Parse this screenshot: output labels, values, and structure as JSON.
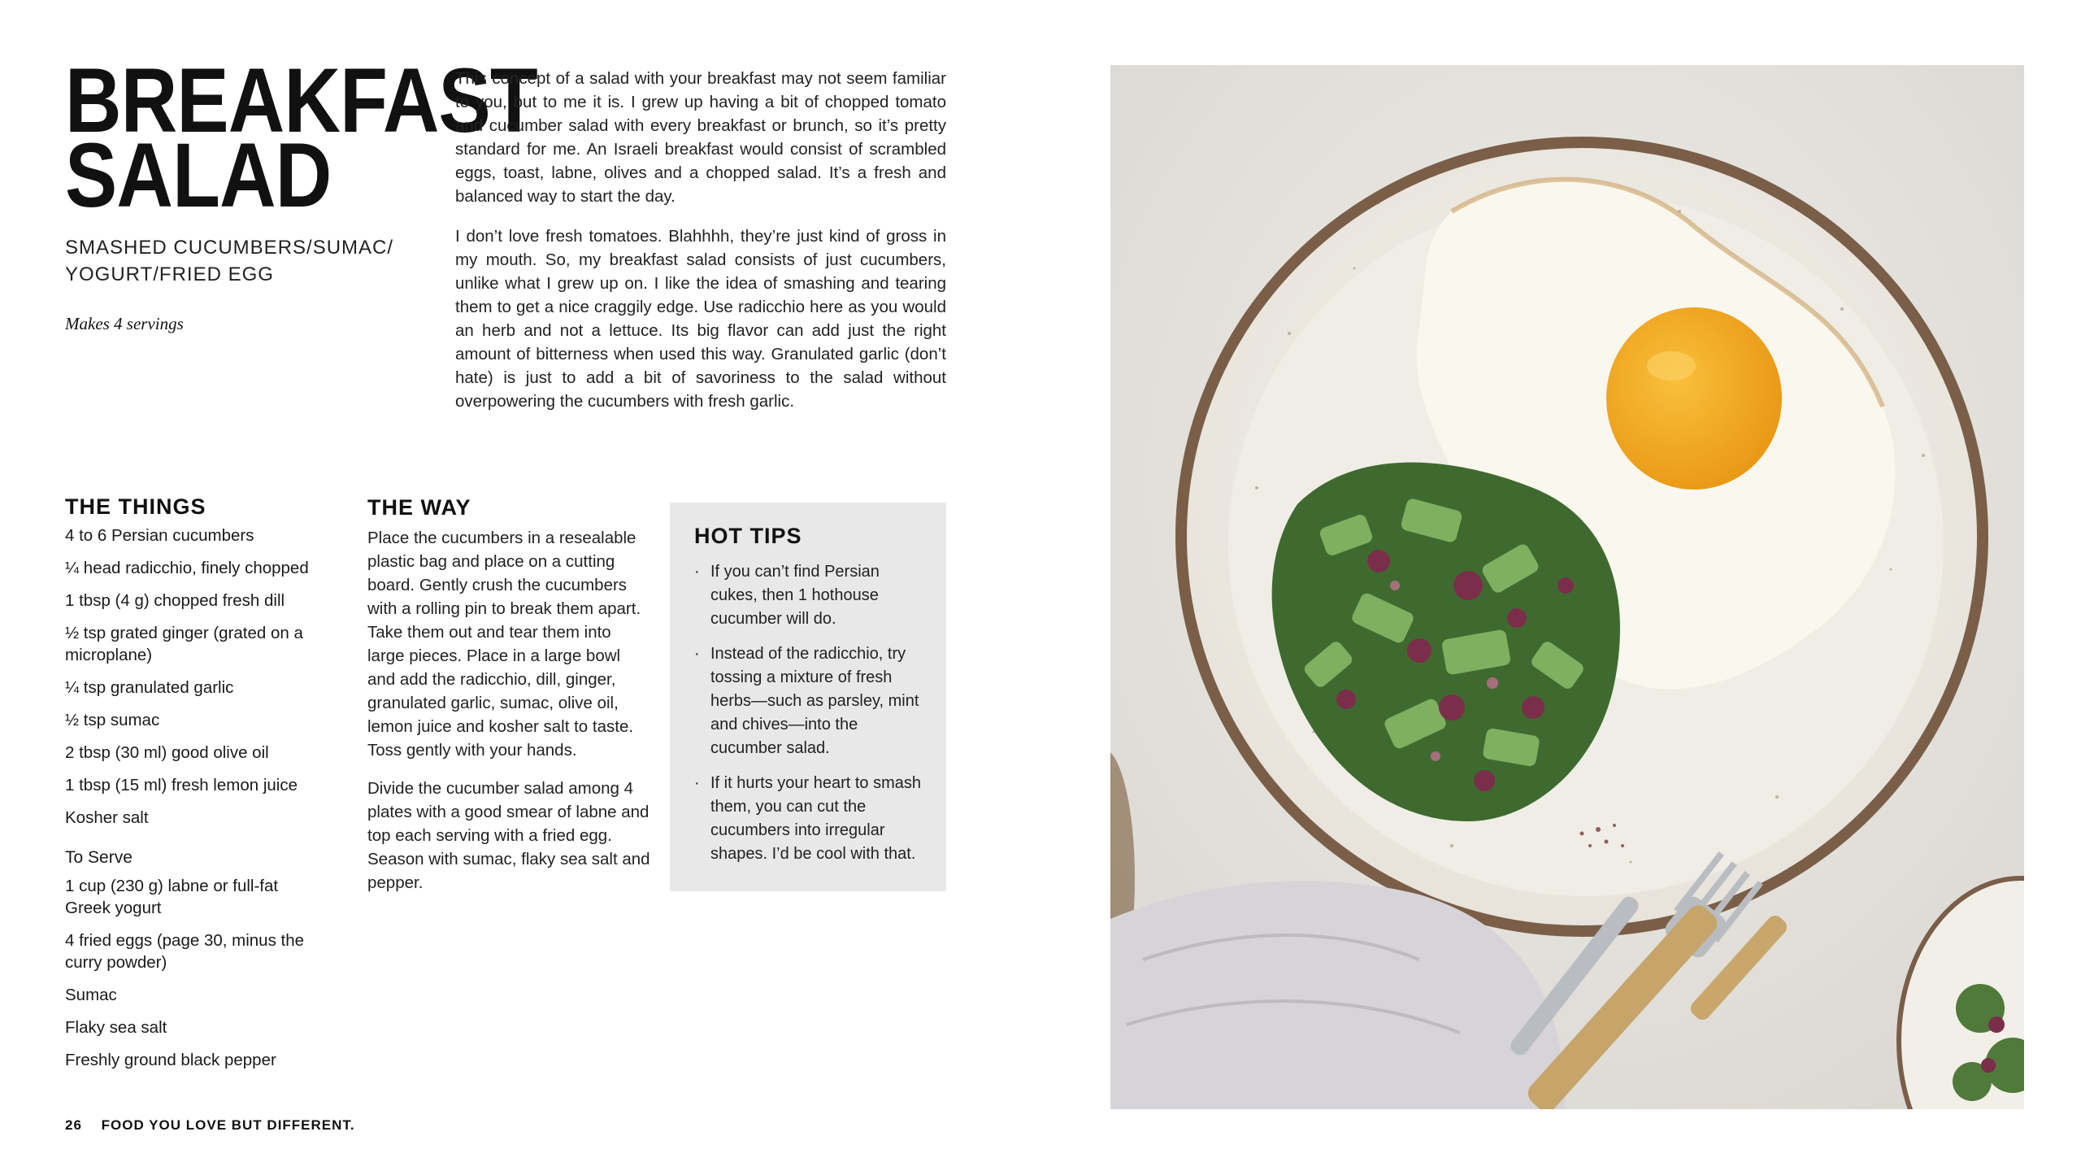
{
  "recipe": {
    "title_line1": "BREAKFAST",
    "title_line2": "SALAD",
    "subtitle_line1": "SMASHED CUCUMBERS/SUMAC/",
    "subtitle_line2": "YOGURT/FRIED EGG",
    "yield": "Makes 4 servings"
  },
  "intro": [
    "This concept of a salad with your breakfast may not seem familiar to you, but to me it is. I grew up having a bit of chopped tomato and cucumber salad with every breakfast or brunch, so it’s pretty standard for me. An Israeli breakfast would consist of scrambled eggs, toast, labne, olives and a chopped salad. It’s a fresh and balanced way to start the day.",
    "I don’t love fresh tomatoes. Blahhhh, they’re just kind of gross in my mouth. So, my breakfast salad consists of just cucumbers, unlike what I grew up on. I like the idea of smashing and tearing them to get a nice craggily edge. Use radicchio here as you would an herb and not a lettuce. Its big flavor can add just the right amount of bitterness when used this way. Granulated garlic (don’t hate) is just to add a bit of savoriness to the salad without overpowering the cucumbers with fresh garlic."
  ],
  "things": {
    "heading": "THE THINGS",
    "items": [
      "4 to 6 Persian cucumbers",
      "¼ head radicchio, finely chopped",
      "1 tbsp (4 g) chopped fresh dill",
      "½ tsp grated ginger (grated on a microplane)",
      "¼ tsp granulated garlic",
      "½ tsp sumac",
      "2 tbsp (30 ml) good olive oil",
      "1 tbsp (15 ml) fresh lemon juice",
      "Kosher salt"
    ],
    "serve_heading": "To Serve",
    "serve_items": [
      "1 cup (230 g) labne or full-fat Greek yogurt",
      "4 fried eggs (page 30, minus the curry powder)",
      "Sumac",
      "Flaky sea salt",
      "Freshly ground black pepper"
    ]
  },
  "way": {
    "heading": "THE WAY",
    "steps": [
      "Place the cucumbers in a resealable plastic bag and place on a cutting board. Gently crush the cucumbers with a rolling pin to break them apart. Take them out and tear them into large pieces. Place in a large bowl and add the radicchio, dill, ginger, granulated garlic, sumac, olive oil, lemon juice and kosher salt to taste. Toss gently with your hands.",
      "Divide the cucumber salad among 4 plates with a good smear of labne and top each serving with a fried egg. Season with sumac, flaky sea salt and pepper."
    ]
  },
  "tips": {
    "heading": "HOT TIPS",
    "bullet": "·",
    "items": [
      "If you can’t find Persian cukes, then 1 hothouse cucumber will do.",
      "Instead of the radicchio, try tossing a mixture of fresh herbs—such as parsley, mint and chives—into the cucumber salad.",
      "If it hurts your heart to smash them, you can cut the cucumbers into irregular shapes. I’d be cool with that."
    ]
  },
  "footer": {
    "page_number": "26",
    "book_title": "FOOD YOU LOVE BUT DIFFERENT."
  },
  "colors": {
    "tips_bg": "#e8e8e9",
    "plate_rim": "#7a5e48",
    "plate": "#f1eee8",
    "yolk": "#f2a516",
    "egg_white": "#faf7ee",
    "cucumber": "#4f7a3a",
    "radicchio": "#7a2e4a",
    "napkin": "#d6d4d8"
  }
}
